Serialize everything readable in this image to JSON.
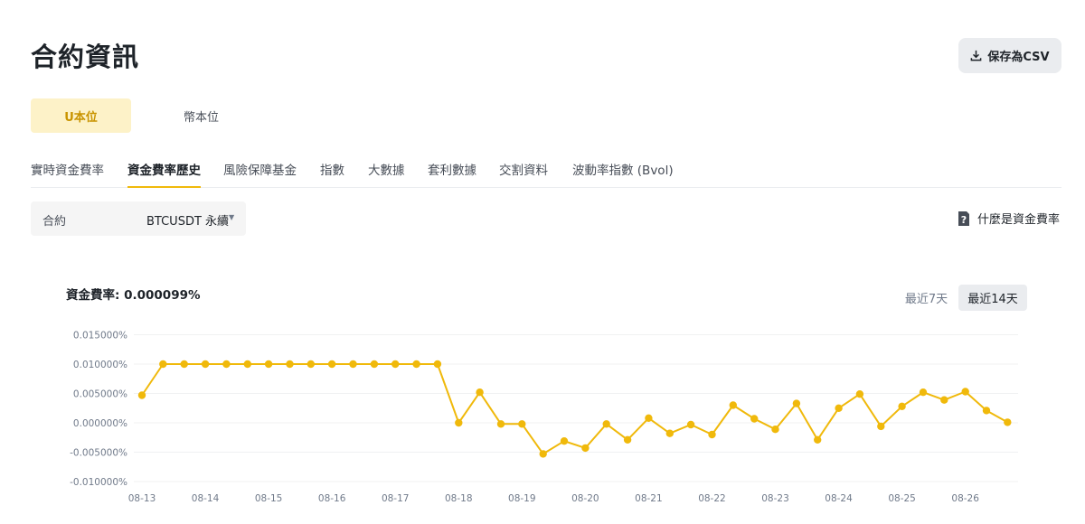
{
  "header": {
    "title": "合約資訊",
    "csv_button": "保存為CSV",
    "csv_icon": "download-icon"
  },
  "margin_tabs": [
    {
      "label": "U本位",
      "active": true
    },
    {
      "label": "幣本位",
      "active": false
    }
  ],
  "sub_tabs": [
    "實時資金費率",
    "資金費率歷史",
    "風險保障基金",
    "指數",
    "大數據",
    "套利數據",
    "交割資料",
    "波動率指數 (Bvol)"
  ],
  "active_sub_tab": "資金費率歷史",
  "contract": {
    "label": "合約",
    "value": "BTCUSDT 永續",
    "caret": "▼"
  },
  "help": {
    "label": "什麼是資金費率",
    "icon": "question-doc-icon"
  },
  "rate_label": "資金費率: 0.000099%",
  "range": {
    "short": "最近7天",
    "long": "最近14天",
    "selected": "最近14天"
  },
  "colors": {
    "accent": "#f0b90b",
    "line": "#f0b90b",
    "active_tab_bg": "#fdf2c8",
    "active_tab_text": "#c99400"
  },
  "chart_data": {
    "type": "line",
    "x_ticks": [
      "08-13",
      "08-14",
      "08-15",
      "08-16",
      "08-17",
      "08-18",
      "08-19",
      "08-20",
      "08-21",
      "08-22",
      "08-23",
      "08-24",
      "08-25",
      "08-26"
    ],
    "y_ticks": [
      "0.015000%",
      "0.010000%",
      "0.005000%",
      "0.000000%",
      "-0.005000%",
      "-0.010000%"
    ],
    "ylim": [
      -0.01,
      0.015
    ],
    "unit": "%",
    "grid": "horizontal",
    "series": [
      {
        "x": [
          "08-13 00:00",
          "08-13 08:00",
          "08-13 16:00",
          "08-14 00:00",
          "08-14 08:00",
          "08-14 16:00",
          "08-15 00:00",
          "08-15 08:00",
          "08-15 16:00",
          "08-16 00:00",
          "08-16 08:00",
          "08-16 16:00",
          "08-17 00:00",
          "08-17 08:00",
          "08-17 16:00",
          "08-18 00:00",
          "08-18 08:00",
          "08-18 16:00",
          "08-19 00:00",
          "08-19 08:00",
          "08-19 16:00",
          "08-20 00:00",
          "08-20 08:00",
          "08-20 16:00",
          "08-21 00:00",
          "08-21 08:00",
          "08-21 16:00",
          "08-22 00:00",
          "08-22 08:00",
          "08-22 16:00",
          "08-23 00:00",
          "08-23 08:00",
          "08-23 16:00",
          "08-24 00:00",
          "08-24 08:00",
          "08-24 16:00",
          "08-25 00:00",
          "08-25 08:00",
          "08-25 16:00",
          "08-26 00:00",
          "08-26 08:00",
          "08-26 16:00"
        ],
        "values": [
          0.0047,
          0.01,
          0.01,
          0.01,
          0.01,
          0.01,
          0.01,
          0.01,
          0.01,
          0.01,
          0.01,
          0.01,
          0.01,
          0.01,
          0.01,
          0.0,
          0.0052,
          -0.0002,
          -0.0002,
          -0.0053,
          -0.0031,
          -0.0043,
          -0.0002,
          -0.0029,
          0.0008,
          -0.0018,
          -0.0003,
          -0.002,
          0.003,
          0.0007,
          -0.0011,
          0.0033,
          -0.0029,
          0.0025,
          0.0049,
          -0.0006,
          0.0028,
          0.0052,
          0.0039,
          0.0053,
          0.0021,
          0.0001
        ]
      }
    ]
  }
}
